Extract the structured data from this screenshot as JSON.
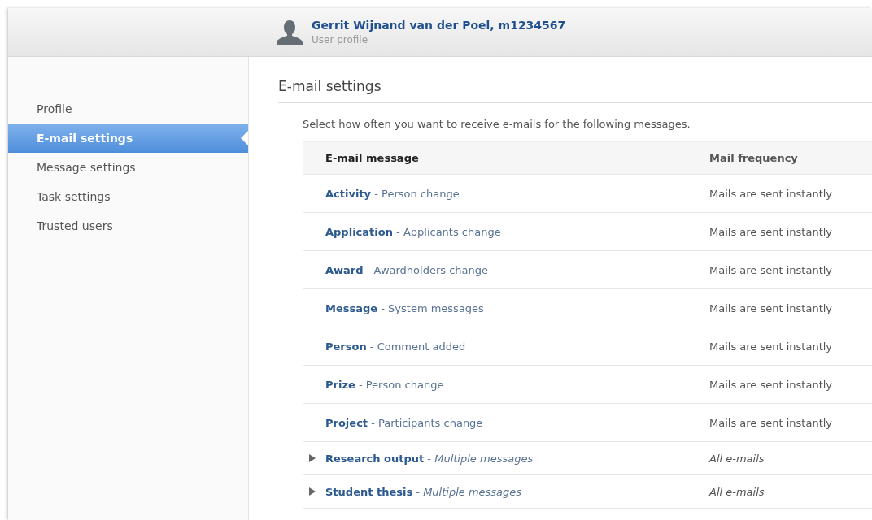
{
  "header": {
    "name": "Gerrit Wijnand van der Poel, m1234567",
    "subtitle": "User profile"
  },
  "sidebar": {
    "items": [
      {
        "label": "Profile",
        "selected": false
      },
      {
        "label": "E-mail settings",
        "selected": true
      },
      {
        "label": "Message settings",
        "selected": false
      },
      {
        "label": "Task settings",
        "selected": false
      },
      {
        "label": "Trusted users",
        "selected": false
      }
    ]
  },
  "content": {
    "title": "E-mail settings",
    "description": "Select how often you want to receive e-mails for the following messages."
  },
  "table": {
    "columns": [
      "E-mail message",
      "Mail frequency"
    ],
    "rows": [
      {
        "kind": "single",
        "message": "**Activity** - Person change",
        "frequency": "Mails are sent instantly"
      },
      {
        "kind": "single",
        "message": "**Application** - Applicants change",
        "frequency": "Mails are sent instantly"
      },
      {
        "kind": "single",
        "message": "**Award** - Awardholders change",
        "frequency": "Mails are sent instantly"
      },
      {
        "kind": "single",
        "message": "**Message** - System messages",
        "frequency": "Mails are sent instantly"
      },
      {
        "kind": "single",
        "message": "**Person** - Comment added",
        "frequency": "Mails are sent instantly"
      },
      {
        "kind": "single",
        "message": "**Prize** - Person change",
        "frequency": "Mails are sent instantly"
      },
      {
        "kind": "single",
        "message": "**Project** - Participants change",
        "frequency": "Mails are sent instantly"
      },
      {
        "kind": "group",
        "expanded": false,
        "message": "**Research output** - *Multiple messages*",
        "frequency": "All e-mails"
      },
      {
        "kind": "group",
        "expanded": false,
        "message": "**Student thesis** - *Multiple messages*",
        "frequency": "All e-mails"
      }
    ]
  }
}
